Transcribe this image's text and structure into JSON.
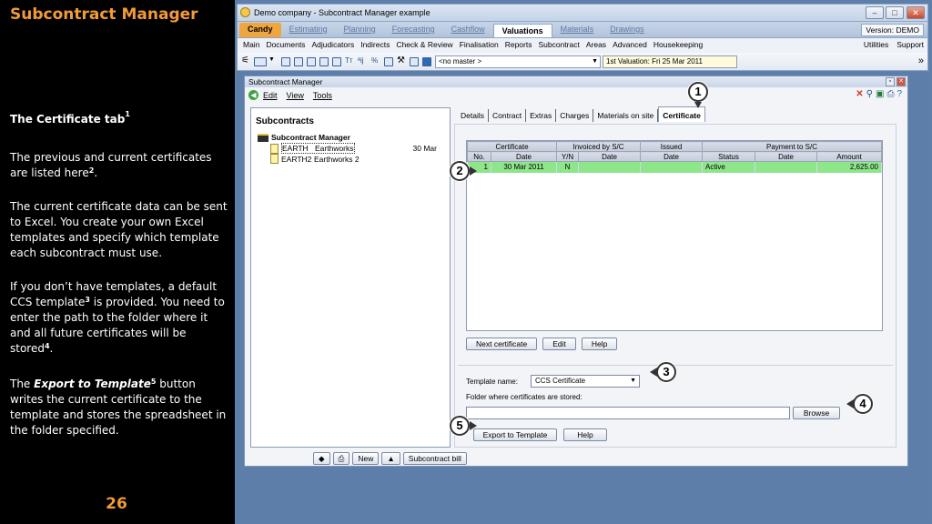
{
  "slide": {
    "title": "Subcontract Manager",
    "section_heading": "The Certificate tab",
    "section_sup": "1",
    "paragraphs": [
      {
        "pre": "The previous and current certificates are listed here",
        "sup": "2",
        "bold": "",
        "post": "."
      },
      {
        "pre": "The current certificate  data can be sent to Excel.  You create your own Excel templates and specify which template each subcontract must use.",
        "sup": "",
        "bold": "",
        "post": ""
      },
      {
        "pre": "If you don’t have templates, a default CCS template",
        "sup": "3",
        "bold": "",
        "post": " is provided.  You need to enter the path to the folder where it and all future certificates will be stored"
      },
      {
        "pre": "The ",
        "bold": "Export to Template",
        "sup": "5",
        "post": " button writes the current certificate to the template and stores the spreadsheet in the folder specified."
      }
    ],
    "para3_sup2": "4",
    "para3_tail": ".",
    "page_number": "26"
  },
  "window": {
    "title": "Demo company - Subcontract Manager example",
    "version": "Version: DEMO",
    "modules": [
      "Candy",
      "Estimating",
      "Planning",
      "Forecasting",
      "Cashflow",
      "Valuations",
      "Materials",
      "Drawings"
    ],
    "active_module": "Valuations",
    "menus": [
      "Main",
      "Documents",
      "Adjudicators",
      "Indirects",
      "Check & Review",
      "Finalisation",
      "Reports",
      "Subcontract",
      "Areas",
      "Advanced",
      "Housekeeping"
    ],
    "right_menus": [
      "Utilities",
      "Support"
    ],
    "master_combo": "<no master >",
    "valuation_combo": "1st Valuation: Fri 25 Mar 2011"
  },
  "inner": {
    "title": "Subcontract Manager",
    "menus": [
      "Edit",
      "View",
      "Tools"
    ],
    "panel_heading": "Subcontracts",
    "root": "Subcontract Manager",
    "subcontracts": [
      {
        "code": "EARTH",
        "name": "Earthworks",
        "date": "30 Mar"
      },
      {
        "code": "EARTH2",
        "name": "Earthworks 2",
        "date": ""
      }
    ],
    "bottom_buttons": {
      "new": "New",
      "bill": "Subcontract bill"
    },
    "tabs": [
      "Details",
      "Contract",
      "Extras",
      "Charges",
      "Materials on site",
      "Certificate"
    ],
    "active_tab": "Certificate",
    "grid": {
      "groups": [
        "Certificate",
        "Invoiced by S/C",
        "Issued",
        "Payment to S/C"
      ],
      "columns": [
        "No.",
        "Date",
        "Y/N",
        "Date",
        "Date",
        "Status",
        "Date",
        "Amount"
      ],
      "rows": [
        {
          "no": "1",
          "cert_date": "30 Mar 2011",
          "invoiced": "N",
          "inv_date": "",
          "issued_date": "",
          "status": "Active",
          "pay_date": "",
          "amount": "2,625.00"
        }
      ]
    },
    "grid_buttons": {
      "next": "Next certificate",
      "edit": "Edit",
      "help": "Help"
    },
    "template_label": "Template name:",
    "template_value": "CCS Certificate",
    "folder_label": "Folder where certificates are stored:",
    "folder_value": "",
    "browse": "Browse",
    "export": "Export to Template",
    "help": "Help"
  },
  "callouts": [
    "1",
    "2",
    "3",
    "4",
    "5"
  ],
  "colors": {
    "accent": "#f29b38",
    "active_row": "#8ee68a",
    "desktop": "#5e7faa"
  }
}
